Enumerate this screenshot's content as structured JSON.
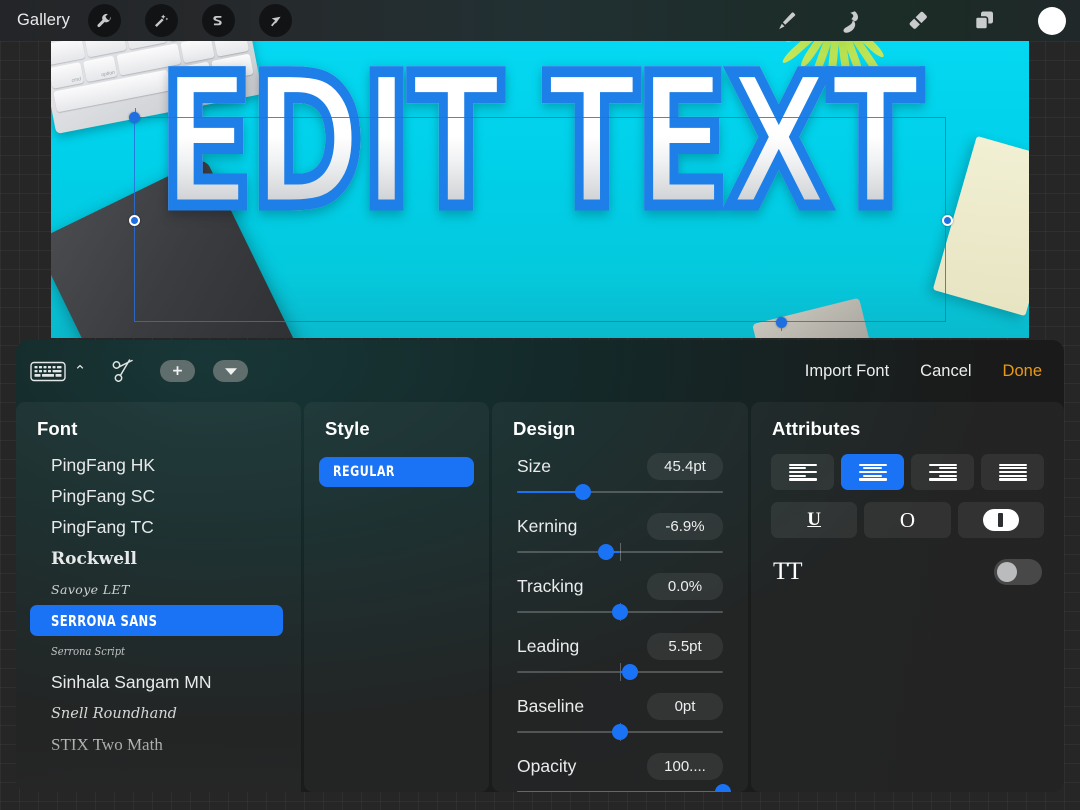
{
  "topbar": {
    "gallery_label": "Gallery",
    "left_tools": [
      {
        "name": "wrench-icon",
        "label": "Actions"
      },
      {
        "name": "magic-wand-icon",
        "label": "Adjustments"
      },
      {
        "name": "s-curve-icon",
        "label": "Selection"
      },
      {
        "name": "arrow-icon",
        "label": "Transform"
      }
    ],
    "right_tools": [
      {
        "name": "paintbrush-icon",
        "label": "Paint"
      },
      {
        "name": "smudge-icon",
        "label": "Smudge"
      },
      {
        "name": "eraser-icon",
        "label": "Erase"
      },
      {
        "name": "layers-icon",
        "label": "Layers"
      }
    ],
    "color_swatch": "#ffffff"
  },
  "canvas": {
    "headline_text": "EDIT TEXT",
    "background_color": "#00cfe8",
    "text_fill_top": "#ffffff",
    "text_fill_bottom": "#bcbfc3",
    "text_stroke_color": "#1f7fe8",
    "selection_color": "#1f6fe0"
  },
  "panel": {
    "header": {
      "keyboard_icon": "keyboard-icon",
      "chevron_up": "⌃",
      "scissors_icon": "scissors-icon",
      "add_icon": "plus-icon",
      "collapse_icon": "chevron-down-icon",
      "import_font_label": "Import Font",
      "cancel_label": "Cancel",
      "done_label": "Done",
      "done_color": "#e89a17"
    },
    "font": {
      "title": "Font",
      "selected": "SERRONA SANS",
      "accent": "#1a72f5",
      "items": [
        {
          "label": "PingFang HK",
          "style": "f-pingfang",
          "selected": false
        },
        {
          "label": "PingFang SC",
          "style": "f-pingfang",
          "selected": false
        },
        {
          "label": "PingFang TC",
          "style": "f-pingfang",
          "selected": false
        },
        {
          "label": "Rockwell",
          "style": "f-rockwell",
          "selected": false
        },
        {
          "label": "Savoye LET",
          "style": "f-script",
          "selected": false
        },
        {
          "label": "SERRONA SANS",
          "style": "f-serrona",
          "selected": true
        },
        {
          "label": "Serrona Script",
          "style": "f-serrona-script",
          "selected": false
        },
        {
          "label": "Sinhala Sangam MN",
          "style": "f-pingfang",
          "selected": false
        },
        {
          "label": "Snell Roundhand",
          "style": "f-snell",
          "selected": false
        },
        {
          "label": "STIX Two Math",
          "style": "f-stix",
          "selected": false
        }
      ]
    },
    "style": {
      "title": "Style",
      "items": [
        {
          "label": "REGULAR",
          "selected": true
        }
      ]
    },
    "design": {
      "title": "Design",
      "rows": [
        {
          "label": "Size",
          "value": "45.4pt",
          "percent": 32,
          "bipolar": false
        },
        {
          "label": "Kerning",
          "value": "-6.9%",
          "percent": 43,
          "bipolar": true
        },
        {
          "label": "Tracking",
          "value": "0.0%",
          "percent": 50,
          "bipolar": true
        },
        {
          "label": "Leading",
          "value": "5.5pt",
          "percent": 55,
          "bipolar": true
        },
        {
          "label": "Baseline",
          "value": "0pt",
          "percent": 50,
          "bipolar": true
        },
        {
          "label": "Opacity",
          "value": "100....",
          "percent": 100,
          "bipolar": false
        }
      ]
    },
    "attributes": {
      "title": "Attributes",
      "alignment": [
        {
          "name": "align-left-icon",
          "label": "Align left",
          "active": false
        },
        {
          "name": "align-center-icon",
          "label": "Align center",
          "active": true
        },
        {
          "name": "align-right-icon",
          "label": "Align right",
          "active": false
        },
        {
          "name": "align-justify-icon",
          "label": "Justify",
          "active": false
        }
      ],
      "styles": [
        {
          "name": "underline-icon",
          "label": "U",
          "active": false
        },
        {
          "name": "outline-icon",
          "label": "O",
          "active": false
        },
        {
          "name": "fill-pill-icon",
          "label": "",
          "active": false
        }
      ],
      "capitalization": {
        "label": "TT",
        "enabled": false
      }
    }
  }
}
